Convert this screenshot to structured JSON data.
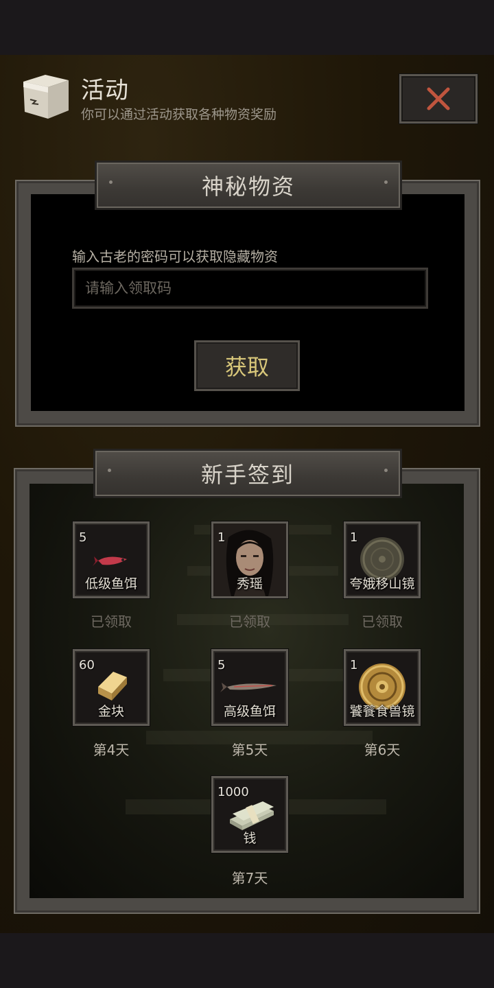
{
  "header": {
    "icon": "box-icon",
    "title": "活动",
    "subtitle": "你可以通过活动获取各种物资奖励",
    "close_icon": "close-x-icon"
  },
  "mystery_panel": {
    "title": "神秘物资",
    "hint": "输入古老的密码可以获取隐藏物资",
    "input_placeholder": "请输入领取码",
    "input_value": "",
    "button_label": "获取"
  },
  "signin_panel": {
    "title": "新手签到",
    "rewards": [
      {
        "qty": "5",
        "name": "低级鱼饵",
        "status": "已领取",
        "icon": "low-bait-icon"
      },
      {
        "qty": "1",
        "name": "秀瑶",
        "status": "已领取",
        "icon": "character-portrait-icon"
      },
      {
        "qty": "1",
        "name": "夸娥移山镜",
        "status": "已领取",
        "icon": "bronze-mirror-icon"
      },
      {
        "qty": "60",
        "name": "金块",
        "status": "第4天",
        "icon": "gold-bar-icon"
      },
      {
        "qty": "5",
        "name": "高级鱼饵",
        "status": "第5天",
        "icon": "high-bait-icon"
      },
      {
        "qty": "1",
        "name": "饕餮食兽镜",
        "status": "第6天",
        "icon": "golden-mirror-icon"
      },
      {
        "qty": "1000",
        "name": "钱",
        "status": "第7天",
        "icon": "money-stack-icon"
      }
    ]
  },
  "colors": {
    "close_x": "#c0553e",
    "claimed_text": "#6f6a62",
    "button_text": "#d8c77a"
  }
}
